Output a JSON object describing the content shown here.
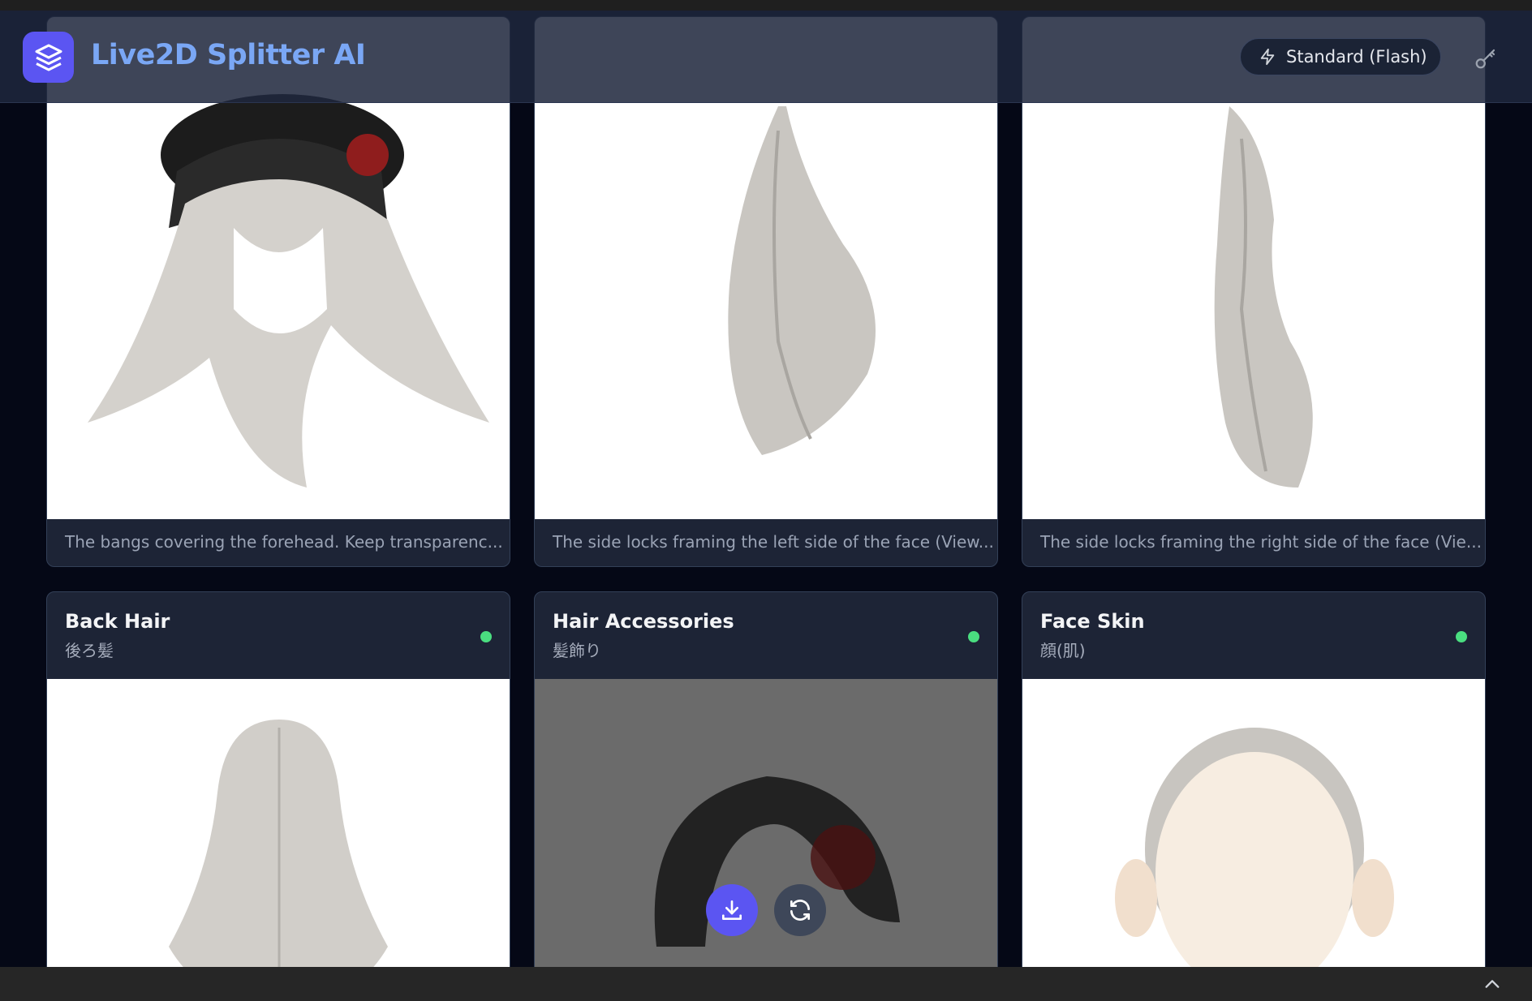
{
  "header": {
    "app_title": "Live2D Splitter AI",
    "model_label": "Standard (Flash)",
    "icons": [
      "layers-icon",
      "flash-icon",
      "key-icon"
    ]
  },
  "cards_row1": [
    {
      "description": "The bangs covering the forehead. Keep transparenc..."
    },
    {
      "description": "The side locks framing the left side of the face (View..."
    },
    {
      "description": "The side locks framing the right side of the face (Vie..."
    }
  ],
  "cards_row2": [
    {
      "title": "Back Hair",
      "subtitle": "後ろ髪",
      "status": "ready"
    },
    {
      "title": "Hair Accessories",
      "subtitle": "髪飾り",
      "status": "ready"
    },
    {
      "title": "Face Skin",
      "subtitle": "顔(肌)",
      "status": "ready"
    }
  ],
  "colors": {
    "accent": "#5b55f2",
    "status_ok": "#4ade80",
    "card_bg": "#1d2436",
    "page_bg": "#050816"
  }
}
